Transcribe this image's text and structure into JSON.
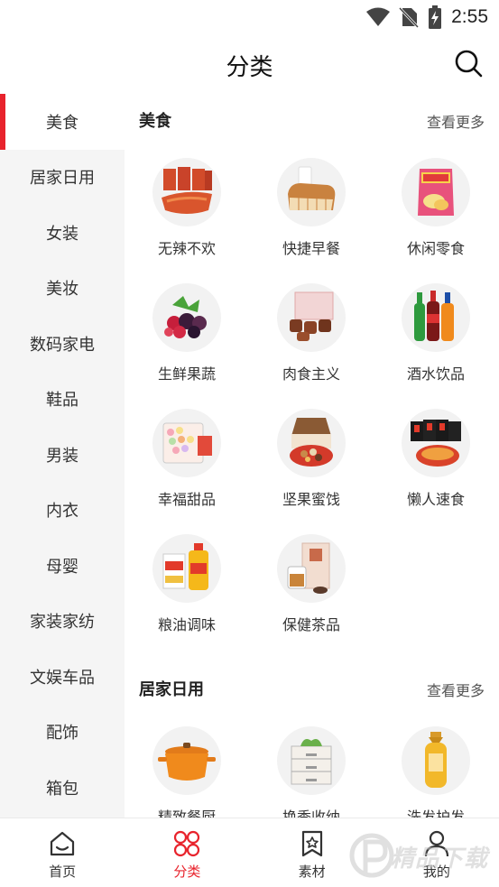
{
  "status": {
    "time": "2:55"
  },
  "header": {
    "title": "分类"
  },
  "sidebar": {
    "items": [
      {
        "label": "美食",
        "active": true
      },
      {
        "label": "居家日用"
      },
      {
        "label": "女装"
      },
      {
        "label": "美妆"
      },
      {
        "label": "数码家电"
      },
      {
        "label": "鞋品"
      },
      {
        "label": "男装"
      },
      {
        "label": "内衣"
      },
      {
        "label": "母婴"
      },
      {
        "label": "家装家纺"
      },
      {
        "label": "文娱车品"
      },
      {
        "label": "配饰"
      },
      {
        "label": "箱包"
      }
    ]
  },
  "sections": [
    {
      "title": "美食",
      "more": "查看更多",
      "items": [
        {
          "label": "无辣不欢",
          "icon": "spicy-snack-icon"
        },
        {
          "label": "快捷早餐",
          "icon": "bread-milk-icon"
        },
        {
          "label": "休闲零食",
          "icon": "chips-bag-icon"
        },
        {
          "label": "生鲜果蔬",
          "icon": "berries-icon"
        },
        {
          "label": "肉食主义",
          "icon": "meat-box-icon"
        },
        {
          "label": "酒水饮品",
          "icon": "drinks-bottles-icon"
        },
        {
          "label": "幸福甜品",
          "icon": "macaron-box-icon"
        },
        {
          "label": "坚果蜜饯",
          "icon": "nuts-box-icon"
        },
        {
          "label": "懒人速食",
          "icon": "instant-noodles-icon"
        },
        {
          "label": "粮油调味",
          "icon": "rice-oil-icon"
        },
        {
          "label": "保健茶品",
          "icon": "tea-box-icon"
        }
      ]
    },
    {
      "title": "居家日用",
      "more": "查看更多",
      "items": [
        {
          "label": "精致餐厨",
          "icon": "pot-icon"
        },
        {
          "label": "换季收纳",
          "icon": "storage-drawer-icon"
        },
        {
          "label": "洗发护发",
          "icon": "shampoo-bottle-icon"
        }
      ]
    }
  ],
  "bottom_nav": [
    {
      "label": "首页",
      "icon": "home-icon"
    },
    {
      "label": "分类",
      "icon": "category-icon",
      "active": true
    },
    {
      "label": "素材",
      "icon": "bookmark-star-icon"
    },
    {
      "label": "我的",
      "icon": "user-icon"
    }
  ],
  "watermark": {
    "text": "精品下载"
  },
  "colors": {
    "accent": "#e8232c",
    "sidebar_bg": "#f5f5f5"
  }
}
